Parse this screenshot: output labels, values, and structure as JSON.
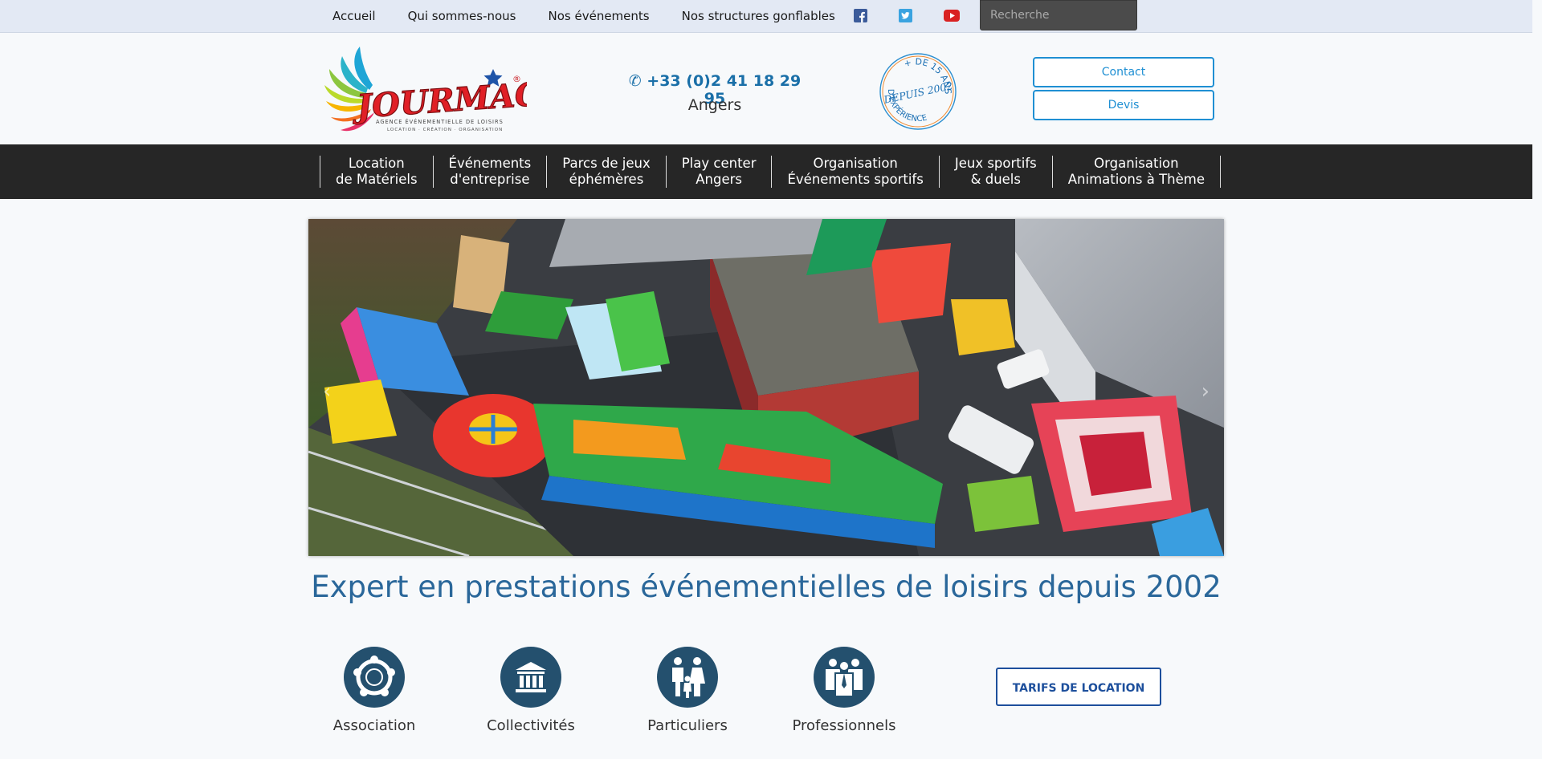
{
  "topnav": {
    "items": [
      "Accueil",
      "Qui sommes-nous",
      "Nos événements",
      "Nos structures gonflables"
    ],
    "social": [
      "facebook-icon",
      "twitter-icon",
      "youtube-icon"
    ],
    "search_placeholder": "Recherche"
  },
  "header": {
    "logo": {
      "brand": "JOURMAGIC",
      "tagline": "AGENCE ÉVÉNEMENTIELLE DE LOISIRS",
      "subline": "LOCATION · CRÉATION · ORGANISATION",
      "mark": "®"
    },
    "phone": "+33 (0)2 41 18 29 95",
    "city": "Angers",
    "stamp": {
      "top": "+ DE 15 ANS",
      "middle": "DEPUIS 2002",
      "bottom": "D'EXPÉRIENCE"
    },
    "buttons": {
      "contact": "Contact",
      "devis": "Devis"
    }
  },
  "mainmenu": [
    {
      "line1": "Location",
      "line2": "de Matériels"
    },
    {
      "line1": "Événements",
      "line2": "d'entreprise"
    },
    {
      "line1": "Parcs de jeux",
      "line2": "éphémères"
    },
    {
      "line1": "Play center",
      "line2": "Angers"
    },
    {
      "line1": "Organisation",
      "line2": "Événements sportifs"
    },
    {
      "line1": "Jeux sportifs",
      "line2": "& duels"
    },
    {
      "line1": "Organisation",
      "line2": "Animations à Thème"
    }
  ],
  "headline": "Expert en prestations événementielles de loisirs depuis 2002",
  "audiences": [
    {
      "label": "Association",
      "icon": "people-circle-icon"
    },
    {
      "label": "Collectivités",
      "icon": "building-columns-icon"
    },
    {
      "label": "Particuliers",
      "icon": "family-icon"
    },
    {
      "label": "Professionnels",
      "icon": "business-people-icon"
    }
  ],
  "cta": "TARIFS DE LOCATION",
  "colors": {
    "accent": "#1f8fd3",
    "menu_bg": "#262626",
    "headline": "#2a679a",
    "icon_bg": "#24506e"
  }
}
